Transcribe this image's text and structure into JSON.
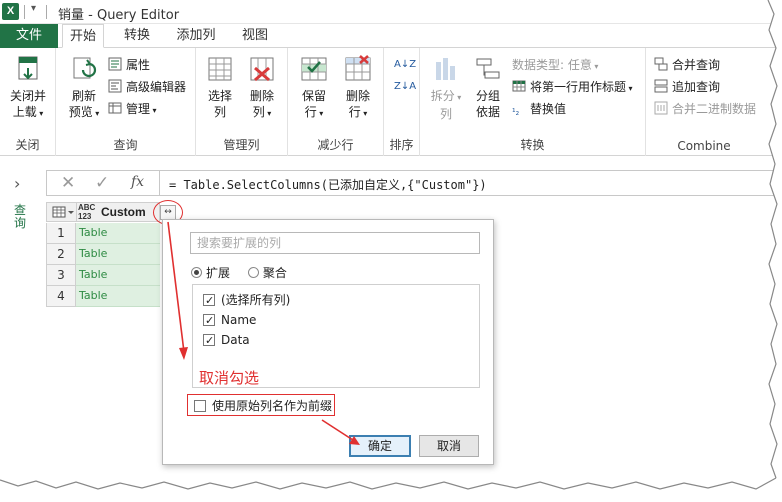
{
  "window": {
    "app_icon": "excel-logo-icon",
    "app_icon_letter": "X",
    "dropdown_glyph": "▾",
    "title": "销量 - Query Editor"
  },
  "tabs": [
    {
      "label": "文件"
    },
    {
      "label": "开始"
    },
    {
      "label": "转换"
    },
    {
      "label": "添加列"
    },
    {
      "label": "视图"
    }
  ],
  "ribbon": {
    "close": {
      "btn_line1": "关闭并",
      "btn_line2": "上载",
      "group": "关闭",
      "icon": "close-load-icon"
    },
    "query": {
      "refresh_line1": "刷新",
      "refresh_line2": "预览",
      "properties": "属性",
      "advanced_editor": "高级编辑器",
      "manage": "管理",
      "group": "查询"
    },
    "manage_columns": {
      "choose_line1": "选择",
      "choose_line2": "列",
      "remove_line1": "删除",
      "remove_line2": "列",
      "group": "管理列"
    },
    "reduce_rows": {
      "keep_line1": "保留",
      "keep_line2": "行",
      "remove_line1": "删除",
      "remove_line2": "行",
      "group": "减少行"
    },
    "sort": {
      "group": "排序",
      "asc": "A↓Z",
      "desc": "Z↓A"
    },
    "transform": {
      "split_line1": "拆分",
      "split_line2": "列",
      "group_line1": "分组",
      "group_line2": "依据",
      "datatype": "数据类型: 任意",
      "first_row_header": "将第一行用作标题",
      "replace_values": "替换值",
      "group": "转换"
    },
    "combine": {
      "merge_queries": "合并查询",
      "append_queries": "追加查询",
      "combine_binaries": "合并二进制数据",
      "group": "Combine"
    }
  },
  "sidebar": {
    "toggle": "›",
    "label": "查询"
  },
  "formula_bar": {
    "cancel_glyph": "✕",
    "ok_glyph": "✓",
    "fx": "fx",
    "formula": "= Table.SelectColumns(已添加自定义,{\"Custom\"})"
  },
  "grid": {
    "type_top": "ABC",
    "type_bottom": "123",
    "column": "Custom",
    "rows": [
      {
        "num": "1",
        "value": "Table"
      },
      {
        "num": "2",
        "value": "Table"
      },
      {
        "num": "3",
        "value": "Table"
      },
      {
        "num": "4",
        "value": "Table"
      }
    ],
    "expand_glyph": "↔"
  },
  "expand_popup": {
    "search_placeholder": "搜索要扩展的列",
    "mode_expand": "扩展",
    "mode_aggregate": "聚合",
    "columns": [
      {
        "label": "(选择所有列)",
        "checked": true
      },
      {
        "label": "Name",
        "checked": true
      },
      {
        "label": "Data",
        "checked": true
      }
    ],
    "prefix_label": "使用原始列名作为前缀",
    "prefix_checked": false,
    "ok": "确定",
    "cancel": "取消"
  },
  "annotation": {
    "text": "取消勾选",
    "color": "#e03030"
  },
  "colors": {
    "accent": "#217346",
    "table_cell_bg": "#dff0e1",
    "table_cell_text": "#2e8b43"
  }
}
